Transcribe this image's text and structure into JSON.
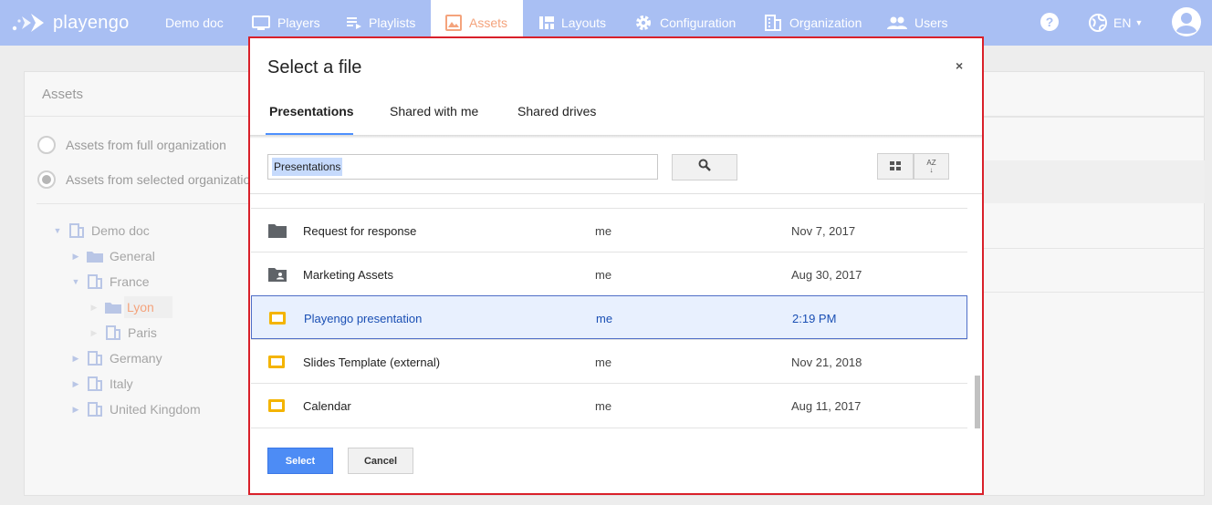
{
  "nav": {
    "brand": "playengo",
    "items": [
      {
        "label": "Demo doc"
      },
      {
        "label": "Players"
      },
      {
        "label": "Playlists"
      },
      {
        "label": "Assets"
      },
      {
        "label": "Layouts"
      },
      {
        "label": "Configuration"
      },
      {
        "label": "Organization"
      },
      {
        "label": "Users"
      }
    ],
    "language": "EN",
    "colors": {
      "bar": "#a9bff3",
      "active_text": "#f4a37c"
    }
  },
  "page": {
    "title": "Assets",
    "radio_full": "Assets from full organization",
    "radio_selected": "Assets from selected organizatio",
    "tree": [
      {
        "label": "Demo doc"
      },
      {
        "label": "General"
      },
      {
        "label": "France"
      },
      {
        "label": "Lyon"
      },
      {
        "label": "Paris"
      },
      {
        "label": "Germany"
      },
      {
        "label": "Italy"
      },
      {
        "label": "United Kingdom"
      }
    ]
  },
  "dialog": {
    "title": "Select a file",
    "close": "×",
    "tabs": [
      {
        "label": "Presentations"
      },
      {
        "label": "Shared with me"
      },
      {
        "label": "Shared drives"
      }
    ],
    "search_chip": "Presentations",
    "sort_label": "AZ",
    "files": [
      {
        "name": "Request for response",
        "owner": "me",
        "date": "Nov 7, 2017",
        "icon": "folder-icon"
      },
      {
        "name": "Marketing Assets",
        "owner": "me",
        "date": "Aug 30, 2017",
        "icon": "shared-folder-icon"
      },
      {
        "name": "Playengo presentation",
        "owner": "me",
        "date": "2:19 PM",
        "icon": "slides-icon"
      },
      {
        "name": "Slides Template (external)",
        "owner": "me",
        "date": "Nov 21, 2018",
        "icon": "slides-icon"
      },
      {
        "name": "Calendar",
        "owner": "me",
        "date": "Aug 11, 2017",
        "icon": "slides-icon"
      }
    ],
    "select_button": "Select",
    "cancel_button": "Cancel",
    "colors": {
      "accent": "#4d8cf5",
      "highlight_border": "#d9202a",
      "slides": "#f4b400"
    }
  }
}
